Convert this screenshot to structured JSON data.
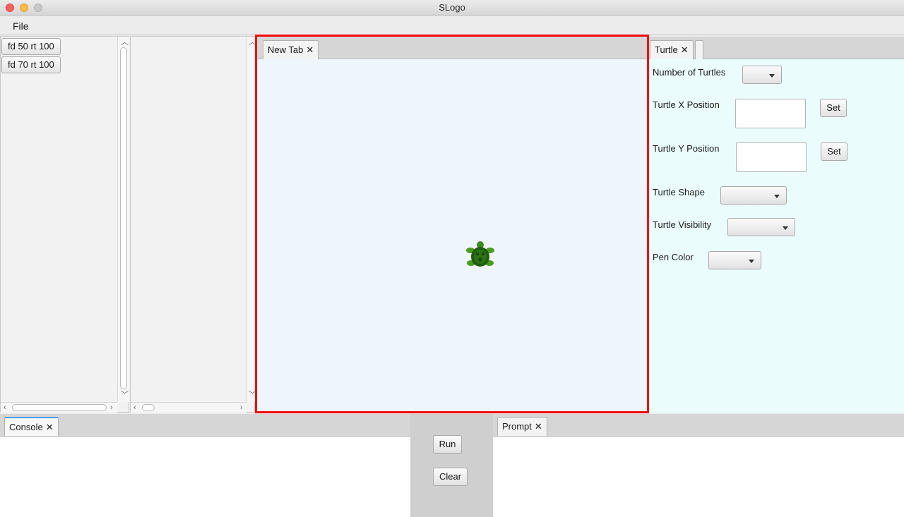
{
  "window": {
    "title": "SLogo"
  },
  "menu": {
    "file": "File"
  },
  "history": {
    "items": [
      "fd 50 rt 100",
      "fd 70 rt 100"
    ]
  },
  "canvas_tab": {
    "label": "New Tab",
    "close": "✕"
  },
  "turtle_tab": {
    "label": "Turtle",
    "close": "✕"
  },
  "settings": {
    "num_turtles_label": "Number of Turtles",
    "x_label": "Turtle X Position",
    "y_label": "Turtle Y Position",
    "set_label": "Set",
    "shape_label": "Turtle Shape",
    "visibility_label": "Turtle Visibility",
    "pen_color_label": "Pen Color"
  },
  "console_tab": {
    "label": "Console",
    "close": "✕"
  },
  "prompt_tab": {
    "label": "Prompt",
    "close": "✕"
  },
  "actions": {
    "run": "Run",
    "clear": "Clear"
  },
  "colors": {
    "highlight": "#f00a0a",
    "canvas_bg": "#eef5fd",
    "settings_bg": "#ebfcfd",
    "tab_accent": "#4f9ce8"
  }
}
